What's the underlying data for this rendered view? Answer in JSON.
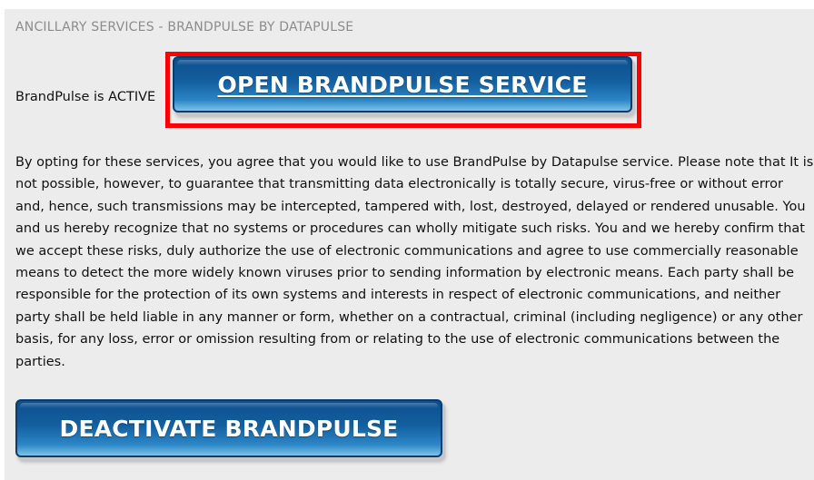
{
  "section": {
    "title": "ANCILLARY SERVICES - BRANDPULSE BY DATAPULSE"
  },
  "status": {
    "text": "BrandPulse is ACTIVE"
  },
  "buttons": {
    "open_label": "OPEN BRANDPULSE SERVICE",
    "deactivate_label": "DEACTIVATE BRANDPULSE"
  },
  "terms": {
    "text": "By opting for these services, you agree that you would like to use BrandPulse by Datapulse service. Please note that It is not possible, however, to guarantee that transmitting data electronically is totally secure, virus-free or without error and, hence, such transmissions may be intercepted, tampered with, lost, destroyed, delayed or rendered unusable. You and us hereby recognize that no systems or procedures can wholly mitigate such risks. You and we hereby confirm that we accept these risks, duly authorize the use of electronic communications and agree to use commercially reasonable means to detect the more widely known viruses prior to sending information by electronic means. Each party shall be responsible for the protection of its own systems and interests in respect of electronic communications, and neither party shall be held liable in any manner or form, whether on a contractual, criminal (including negligence) or any other basis, for any loss, error or omission resulting from or relating to the use of electronic communications between the parties."
  },
  "colors": {
    "highlight": "#ff0000",
    "button_blue": "#135f9f",
    "panel_bg": "#ececec",
    "title_gray": "#8c8c8c"
  }
}
